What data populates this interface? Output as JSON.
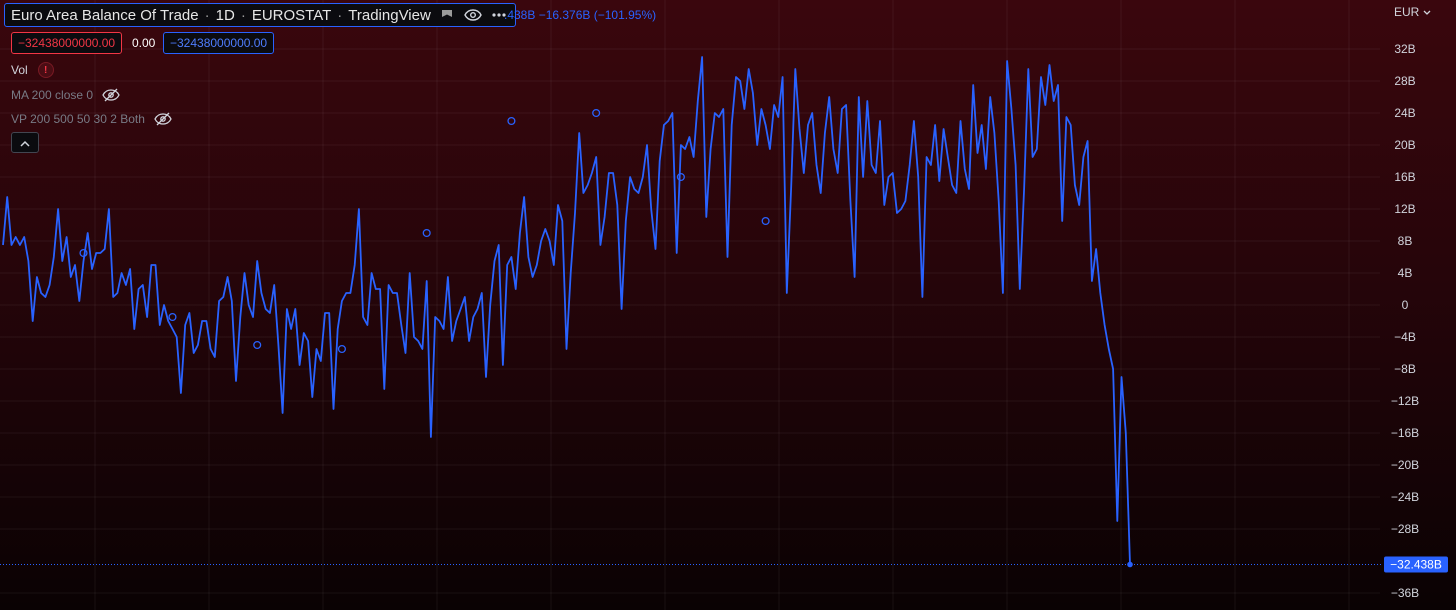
{
  "header": {
    "title": "Euro Area Balance Of Trade",
    "interval": "1D",
    "source": "EUROSTAT",
    "provider": "TradingView",
    "change": ".438B −16.376B (−101.95%)",
    "price_red": "−32438000000.00",
    "price_mid": "0.00",
    "price_blue": "−32438000000.00"
  },
  "indicators": {
    "vol": "Vol",
    "vol_warning": "!",
    "ma": "MA 200 close 0",
    "vp": "VP 200 500 50 30 2 Both"
  },
  "axis": {
    "currency": "EUR",
    "ticks": [
      "32B",
      "28B",
      "24B",
      "20B",
      "16B",
      "12B",
      "8B",
      "4B",
      "0",
      "−4B",
      "−8B",
      "−12B",
      "−16B",
      "−20B",
      "−24B",
      "−28B",
      "−36B"
    ],
    "last_label": "−32.438B"
  },
  "colors": {
    "line": "#2962ff",
    "label_bg": "#2962ff",
    "alert": "#f23645"
  },
  "icons": [
    "flag-icon",
    "eye-icon",
    "more-icon",
    "eye-off-icon",
    "chevron-up-icon",
    "chevron-down-icon"
  ],
  "chart_data": {
    "type": "line",
    "title": "Euro Area Balance Of Trade",
    "xlabel": "",
    "ylabel": "",
    "ylim": [
      -37.5,
      34
    ],
    "grid": true,
    "x_ticks": [],
    "series": [
      {
        "name": "Euro Area Balance Of Trade",
        "values": [
          7.5,
          13.5,
          7.5,
          8.5,
          7.5,
          8.5,
          5.5,
          -2.0,
          3.5,
          1.5,
          1.0,
          2.5,
          6.0,
          12.0,
          5.5,
          8.5,
          3.5,
          5.0,
          0.5,
          5.5,
          9.0,
          4.5,
          6.5,
          6.5,
          7.0,
          12.0,
          1.0,
          1.5,
          4.0,
          2.5,
          4.5,
          -3.0,
          2.0,
          2.5,
          -1.5,
          5.0,
          5.0,
          -2.5,
          0.0,
          -2.0,
          -3.0,
          -4.0,
          -11.0,
          -2.5,
          -1.0,
          -6.0,
          -5.0,
          -2.0,
          -2.0,
          -5.5,
          -6.5,
          0.5,
          1.0,
          3.5,
          0.5,
          -9.5,
          -1.5,
          4.0,
          0.0,
          -1.5,
          5.5,
          1.5,
          -0.5,
          -1.0,
          2.5,
          -5.0,
          -13.5,
          -0.5,
          -3.0,
          -0.5,
          -7.5,
          -3.5,
          -4.5,
          -11.5,
          -5.5,
          -7.0,
          -1.0,
          -1.0,
          -13.0,
          -3.0,
          0.5,
          1.5,
          1.5,
          5.0,
          12.0,
          -1.5,
          -2.5,
          4.0,
          2.0,
          2.0,
          -10.5,
          2.5,
          1.5,
          1.5,
          -2.5,
          -6.0,
          4.0,
          -4.0,
          -4.5,
          -5.5,
          3.0,
          -16.5,
          -1.5,
          -2.0,
          -3.0,
          3.5,
          -4.5,
          -2.0,
          -0.5,
          1.0,
          -4.5,
          -1.5,
          -0.5,
          1.5,
          -9.0,
          0.0,
          5.5,
          7.5,
          -7.5,
          5.0,
          6.0,
          2.0,
          9.0,
          13.5,
          6.0,
          3.5,
          5.0,
          8.0,
          9.5,
          8.0,
          5.0,
          12.5,
          10.5,
          -5.5,
          4.0,
          11.5,
          21.5,
          14.0,
          15.0,
          16.5,
          18.5,
          7.5,
          11.0,
          16.5,
          16.5,
          12.5,
          -0.5,
          10.5,
          16.0,
          14.5,
          14.0,
          16.0,
          20.0,
          12.0,
          7.0,
          18.0,
          22.5,
          23.0,
          24.0,
          6.5,
          20.0,
          19.5,
          21.0,
          18.5,
          25.5,
          31.0,
          11.0,
          19.5,
          24.0,
          23.5,
          24.5,
          6.0,
          22.5,
          28.5,
          28.0,
          24.5,
          29.5,
          26.5,
          20.0,
          24.5,
          22.5,
          19.5,
          25.0,
          23.5,
          28.5,
          1.5,
          14.5,
          29.5,
          22.0,
          16.5,
          22.5,
          24.0,
          17.5,
          14.0,
          21.5,
          26.0,
          19.5,
          16.5,
          24.5,
          25.0,
          13.0,
          3.5,
          26.0,
          16.0,
          25.5,
          17.5,
          16.5,
          23.0,
          12.5,
          16.0,
          16.5,
          11.5,
          12.0,
          13.0,
          17.5,
          23.0,
          16.0,
          1.0,
          18.5,
          17.5,
          22.5,
          15.5,
          22.0,
          18.5,
          15.0,
          14.0,
          23.0,
          17.0,
          14.5,
          27.5,
          19.0,
          22.5,
          17.0,
          26.0,
          21.5,
          13.0,
          1.5,
          30.5,
          24.5,
          17.5,
          2.0,
          14.5,
          29.5,
          18.5,
          19.5,
          28.5,
          25.0,
          30.0,
          25.5,
          27.5,
          10.5,
          23.5,
          22.5,
          15.0,
          12.5,
          18.5,
          20.5,
          3.0,
          7.0,
          1.5,
          -2.5,
          -5.5,
          -8.0,
          -27.0,
          -9.0,
          -16.0,
          -32.438
        ]
      }
    ],
    "markers": [
      {
        "index": 19,
        "value": 6.5
      },
      {
        "index": 40,
        "value": -1.5
      },
      {
        "index": 60,
        "value": -5.0
      },
      {
        "index": 80,
        "value": -5.5
      },
      {
        "index": 100,
        "value": 9.0
      },
      {
        "index": 120,
        "value": 23.0
      },
      {
        "index": 140,
        "value": 24.0
      },
      {
        "index": 160,
        "value": 16.0
      },
      {
        "index": 180,
        "value": 10.5
      }
    ],
    "last_value": -32.438
  }
}
